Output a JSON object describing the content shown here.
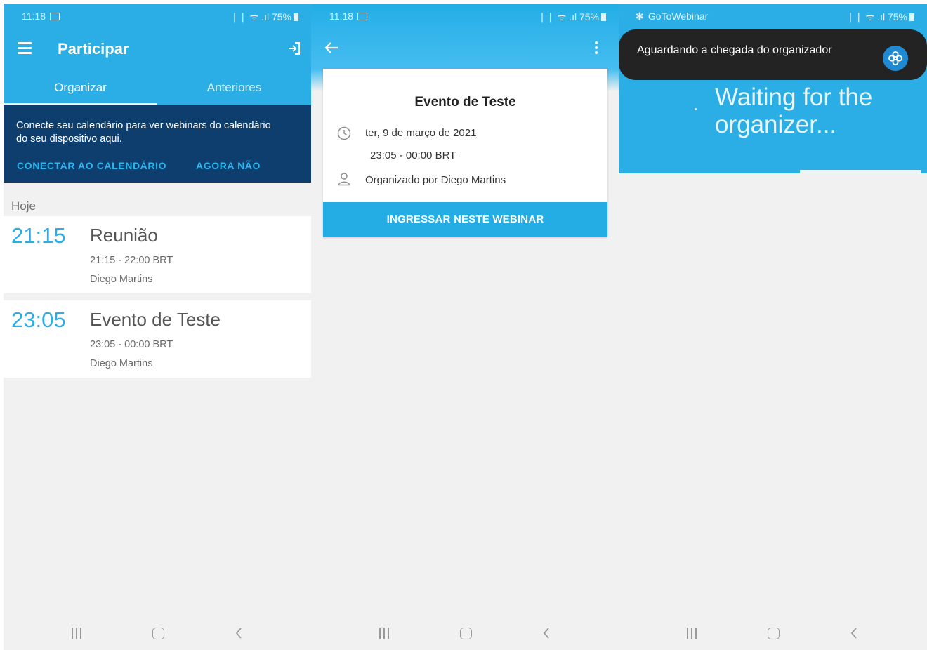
{
  "panels": {
    "participar": {
      "status": {
        "time": "11:18",
        "indicators": "❘❘ ᯤ .ıl",
        "battery": "75%"
      },
      "title": "Participar",
      "tabs": [
        {
          "label": "Organizar",
          "active": true
        },
        {
          "label": "Anteriores",
          "active": false
        }
      ],
      "calendar_banner": {
        "text": "Conecte seu calendário para ver webinars do calendário do seu dispositivo aqui.",
        "connect_label": "CONECTAR AO CALENDÁRIO",
        "not_now_label": "AGORA NÃO"
      },
      "section_label": "Hoje",
      "events": [
        {
          "time": "21:15",
          "title": "Reunião",
          "range": "21:15 - 22:00 BRT",
          "organizer": "Diego Martins"
        },
        {
          "time": "23:05",
          "title": "Evento de Teste",
          "range": "23:05 - 00:00 BRT",
          "organizer": "Diego Martins"
        }
      ]
    },
    "details": {
      "status": {
        "time": "11:18",
        "indicators": "❘❘ ᯤ .ıl",
        "battery": "75%"
      },
      "title": "Evento de Teste",
      "date": "ter, 9 de março de 2021",
      "time_range": "23:05 - 00:00 BRT",
      "organizer": "Organizado por Diego Martins",
      "join_label": "INGRESSAR NESTE WEBINAR"
    },
    "waiting": {
      "app_label": "GoToWebinar",
      "status": {
        "indicators": "❘❘ ᯤ .ıl",
        "battery": "75%"
      },
      "toast_text": "Aguardando a chegada do organizador",
      "waiting_text": "Waiting for the organizer...",
      "dot": "."
    }
  },
  "colors": {
    "primary": "#2aaee5",
    "banner": "#0d3e6e",
    "link": "#2ab6ee",
    "toast": "#232323",
    "background": "#f1f1f1"
  },
  "icons": {
    "menu": "hamburger-icon",
    "signin": "sign-in-icon",
    "back": "arrow-left-icon",
    "more": "more-vert-icon",
    "clock": "clock-icon",
    "person": "person-icon",
    "app_logo": "gotowebinar-logo-icon",
    "nav_recent": "recent-apps-icon",
    "nav_home": "home-icon",
    "nav_back": "chevron-left-icon"
  }
}
